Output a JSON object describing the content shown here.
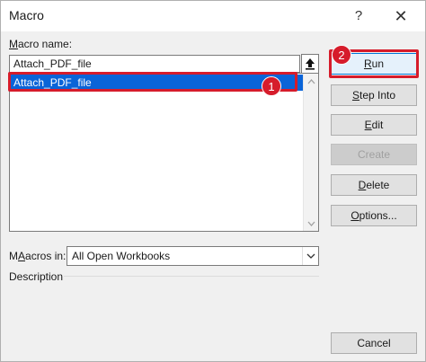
{
  "window": {
    "title": "Macro",
    "help_glyph": "?",
    "close_glyph": "✕"
  },
  "macro_name": {
    "label_prefix": "",
    "label_mnemonic": "M",
    "label_rest": "acro name:",
    "value": "Attach_PDF_file"
  },
  "macro_list": {
    "items": [
      "Attach_PDF_file"
    ],
    "selected_index": 0
  },
  "macros_in": {
    "label_mnemonic": "A",
    "label_prefix": "M",
    "label_rest_before": "acros in:",
    "selected": "All Open Workbooks"
  },
  "description": {
    "label": "Description"
  },
  "buttons": {
    "run": {
      "mnemonic": "R",
      "rest": "un"
    },
    "step_into": {
      "mnemonic": "S",
      "rest": "tep Into"
    },
    "edit": {
      "mnemonic": "E",
      "rest": "dit"
    },
    "create": {
      "mnemonic": "",
      "rest": "Create"
    },
    "delete": {
      "mnemonic": "D",
      "rest": "elete"
    },
    "options": {
      "mnemonic": "O",
      "rest": "ptions..."
    },
    "cancel": {
      "mnemonic": "",
      "rest": "Cancel"
    }
  },
  "annotations": {
    "badge_1": "1",
    "badge_2": "2",
    "highlight_color": "#d61c2b"
  }
}
